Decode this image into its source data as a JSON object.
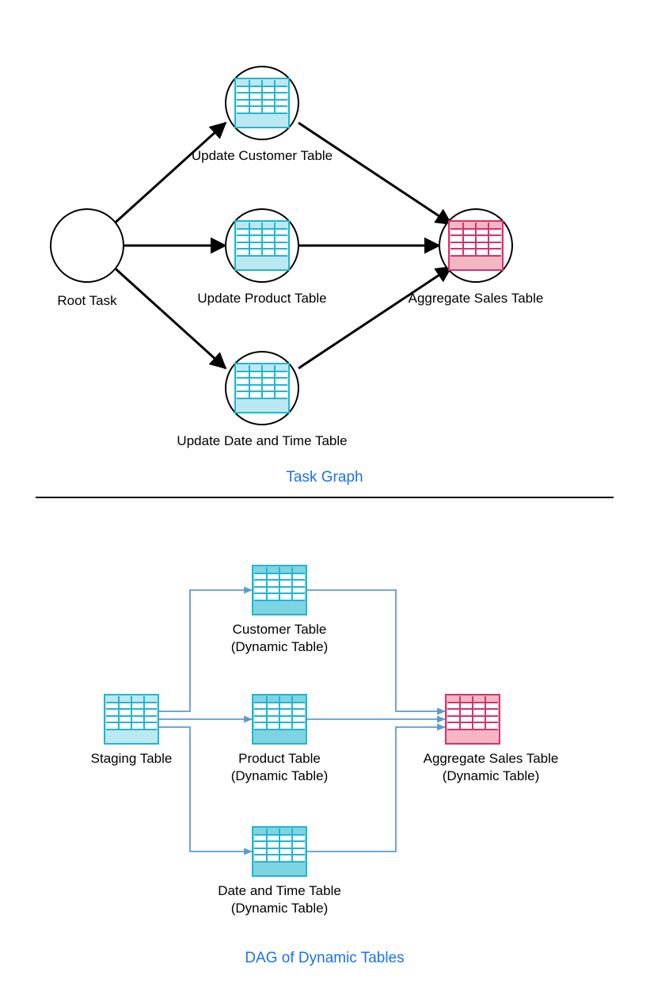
{
  "top_title": "Task Graph",
  "bottom_title": "DAG of Dynamic Tables",
  "top": {
    "root": {
      "label": "Root Task"
    },
    "customer": {
      "label": "Update Customer Table"
    },
    "product": {
      "label": "Update Product Table"
    },
    "datetime": {
      "label": "Update Date and Time Table"
    },
    "agg": {
      "label": "Aggregate Sales Table"
    }
  },
  "bottom": {
    "staging": {
      "label": "Staging Table"
    },
    "customer": {
      "label1": "Customer Table",
      "label2": "(Dynamic Table)"
    },
    "product": {
      "label1": "Product Table",
      "label2": "(Dynamic Table)"
    },
    "datetime": {
      "label1": "Date and Time Table",
      "label2": "(Dynamic Table)"
    },
    "agg": {
      "label1": "Aggregate Sales Table",
      "label2": "(Dynamic Table)"
    }
  }
}
